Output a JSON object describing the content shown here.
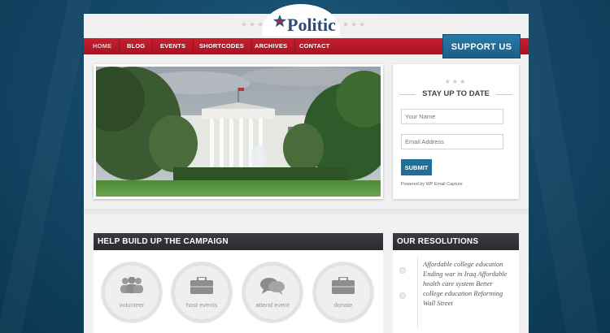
{
  "header": {
    "logo_text": "Politic",
    "nav": [
      "HOME",
      "BLOG",
      "EVENTS",
      "SHORTCODES",
      "ARCHIVES",
      "CONTACT"
    ],
    "support_label": "SUPPORT US"
  },
  "signup": {
    "title": "STAY UP TO DATE",
    "name_placeholder": "Your Name",
    "email_placeholder": "Email Address",
    "submit_label": "SUBMIT",
    "powered_by": "Powered by WP Email Capture"
  },
  "campaign": {
    "title": "HELP BUILD UP THE CAMPAIGN",
    "items": [
      {
        "label": "volunteer",
        "icon": "people-icon"
      },
      {
        "label": "host events",
        "icon": "briefcase-icon"
      },
      {
        "label": "attend event",
        "icon": "chat-icon"
      },
      {
        "label": "donate",
        "icon": "briefcase-icon"
      }
    ]
  },
  "resolutions": {
    "title": "OUR RESOLUTIONS",
    "text": "Affordable college education Ending war in Iraq Affordable health care system Better college education Reforming Wall Street"
  },
  "colors": {
    "nav_red": "#b81a2a",
    "support_blue": "#1f6f99",
    "section_dark": "#34313a",
    "background_blue": "#144a69"
  }
}
